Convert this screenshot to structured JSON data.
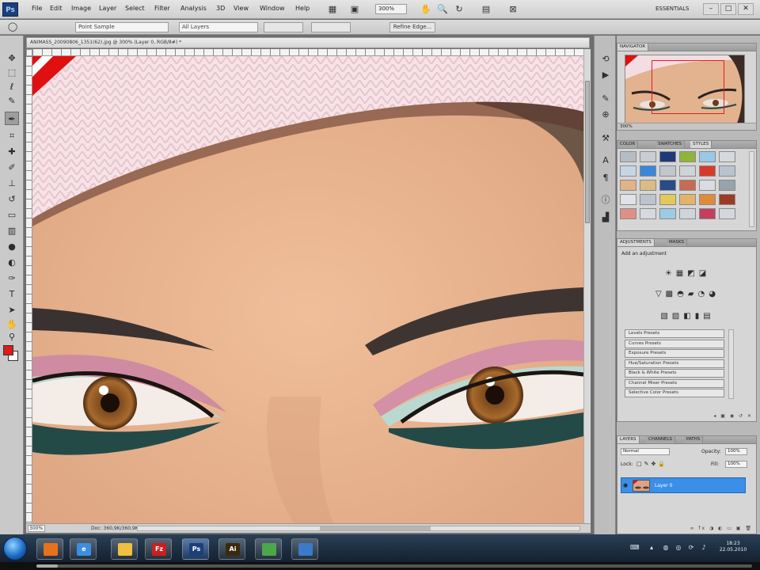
{
  "menubar": {
    "logo": "Ps",
    "items": [
      "File",
      "Edit",
      "Image",
      "Layer",
      "Select",
      "Filter",
      "Analysis",
      "3D",
      "View",
      "Window",
      "Help"
    ],
    "zoom": "300%",
    "workspace": "ESSENTIALS"
  },
  "options": {
    "sample_size": "Point Sample",
    "sample": "All Layers",
    "refine_edge": "Refine Edge..."
  },
  "document": {
    "tab_title": "ANIMASS_20090806_1351(62).jpg @ 300% (Layer 0, RGB/8#) *",
    "zoom": "300%",
    "doc_info": "Doc: 360,9K/360,9K"
  },
  "navigator": {
    "tab": "NAVIGATOR",
    "zoom": "300%"
  },
  "color_panel": {
    "tabs": [
      "COLOR",
      "SWATCHES",
      "STYLES"
    ],
    "swatches": [
      "#b6bcc4",
      "#c9ccd2",
      "#1d3a76",
      "#8fb43c",
      "#9ac8e8",
      "#d5d9de",
      "#c6d6e5",
      "#3c86d8",
      "#bfc6cc",
      "#cfd4d8",
      "#d83b2a",
      "#b9c3d0",
      "#e0b38a",
      "#d8bd8a",
      "#2a4c86",
      "#c86b55",
      "#d9dde2",
      "#98a3ad",
      "#dfe3e8",
      "#bcc5ce",
      "#e3c95a",
      "#e4b36a",
      "#e08b3a",
      "#9c3b22",
      "#e08f86",
      "#d6d9dd",
      "#9ccbe5",
      "#cfd5db",
      "#c43f5e",
      "#d3d7dc"
    ]
  },
  "adjustments": {
    "tabs": [
      "ADJUSTMENTS",
      "MASKS"
    ],
    "title": "Add an adjustment",
    "presets": [
      "Levels Presets",
      "Curves Presets",
      "Exposure Presets",
      "Hue/Saturation Presets",
      "Black & White Presets",
      "Channel Mixer Presets",
      "Selective Color Presets"
    ]
  },
  "layers": {
    "tabs": [
      "LAYERS",
      "CHANNELS",
      "PATHS"
    ],
    "blend_mode": "Normal",
    "opacity_label": "Opacity:",
    "opacity": "100%",
    "lock_label": "Lock:",
    "fill_label": "Fill:",
    "fill": "100%",
    "layer_name": "Layer 0"
  },
  "taskbar": {
    "apps": [
      {
        "name": "firefox",
        "glyph": "",
        "color": "#e8721c"
      },
      {
        "name": "internet-explorer",
        "glyph": "e",
        "color": "#3b8ee0"
      },
      {
        "name": "explorer",
        "glyph": "",
        "color": "#f0c040"
      },
      {
        "name": "filezilla",
        "glyph": "Fz",
        "color": "#c82020"
      },
      {
        "name": "photoshop",
        "glyph": "Ps",
        "color": "#1c3f7a"
      },
      {
        "name": "illustrator",
        "glyph": "Ai",
        "color": "#3a2a0c"
      },
      {
        "name": "network",
        "glyph": "",
        "color": "#4aa84a"
      },
      {
        "name": "display",
        "glyph": "",
        "color": "#3a7ac8"
      }
    ],
    "time": "18:23",
    "date": "22.05.2010",
    "video_progress": 0.03
  }
}
